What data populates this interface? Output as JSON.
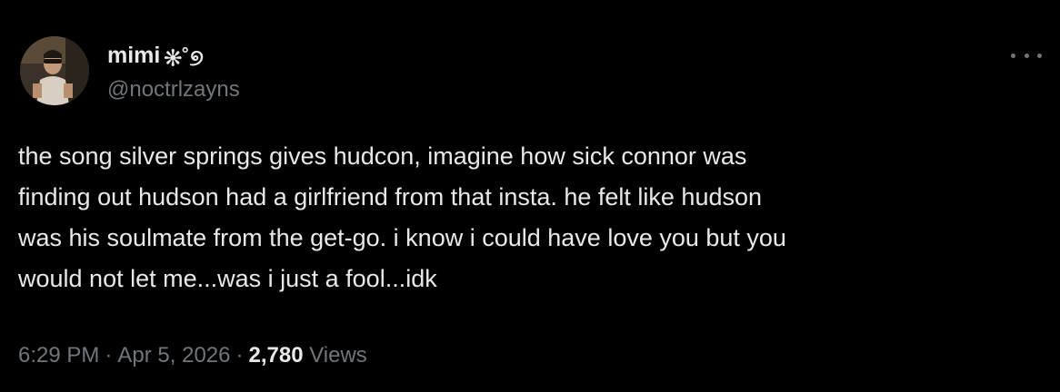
{
  "user": {
    "display_name": "mimi",
    "name_emoji": "❊˚୭",
    "handle": "@noctrlzayns"
  },
  "tweet": {
    "text": "the song silver springs gives hudcon, imagine how sick connor was\nfinding out hudson had a girlfriend from that insta. he felt like hudson\nwas his soulmate from the get-go. i know i could have love you but you\nwould not let me...was i just a fool...idk"
  },
  "meta": {
    "time": "6:29 PM",
    "separator": "·",
    "date": "Apr 5, 2026",
    "views_count": "2,780",
    "views_label": "Views"
  },
  "icons": {
    "more": "more-options-icon",
    "avatar": "avatar-photo"
  },
  "colors": {
    "background": "#000000",
    "primary_text": "#e7e9ea",
    "secondary_text": "#71767b"
  }
}
